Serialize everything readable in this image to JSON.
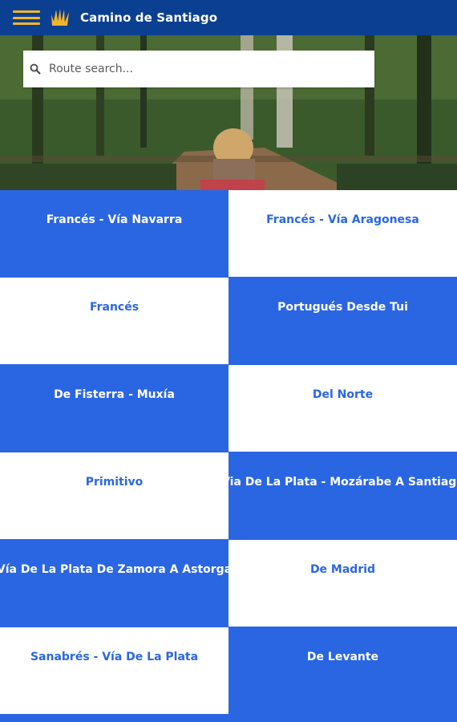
{
  "app": {
    "title": "Camino de Santiago",
    "brand_color": "#0b3f91",
    "accent_color": "#f2b52a",
    "tile_blue": "#2a66e2"
  },
  "icons": {
    "menu": "hamburger-menu-icon",
    "logo": "scallop-shell-icon",
    "search": "search-icon"
  },
  "search": {
    "placeholder": "Route search..."
  },
  "routes": [
    {
      "label": "Francés - Vía Navarra"
    },
    {
      "label": "Francés - Vía Aragonesa"
    },
    {
      "label": "Francés"
    },
    {
      "label": "Portugués Desde Tui"
    },
    {
      "label": "De Fisterra - Muxía"
    },
    {
      "label": "Del Norte"
    },
    {
      "label": "Primitivo"
    },
    {
      "label": "Via De La Plata - Mozárabe A Santiago"
    },
    {
      "label": "Vía De La Plata De Zamora A Astorga"
    },
    {
      "label": "De Madrid"
    },
    {
      "label": "Sanabrés - Vía De La Plata"
    },
    {
      "label": "De Levante"
    }
  ]
}
